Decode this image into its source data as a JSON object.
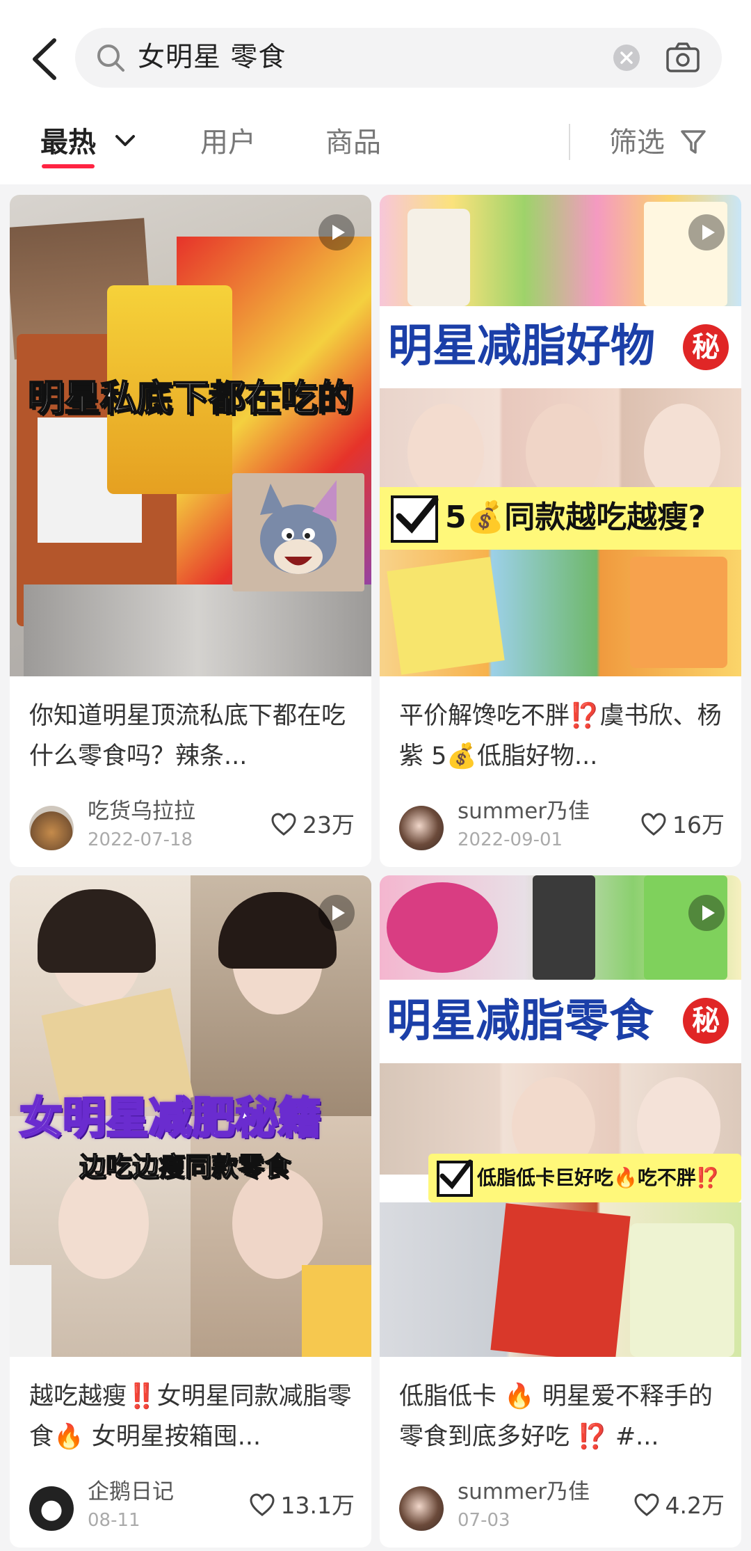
{
  "search": {
    "query": "女明星 零食"
  },
  "tabs": [
    {
      "label": "最热"
    },
    {
      "label": "用户"
    },
    {
      "label": "商品"
    },
    {
      "label": "筛选"
    }
  ],
  "cards": [
    {
      "overlay": "明星私底下都在吃的",
      "title": "你知道明星顶流私底下都在吃什么零食吗？辣条...",
      "author": "吃货乌拉拉",
      "date": "2022-07-18",
      "likes": "23万"
    },
    {
      "overlay": "明星减脂好物",
      "overlay_badge": "秘",
      "overlay2": "5💰同款越吃越瘦?",
      "title": "平价解馋吃不胖⁉️虞书欣、杨紫 5💰低脂好物...",
      "author": "summer乃佳",
      "date": "2022-09-01",
      "likes": "16万"
    },
    {
      "overlay": "女明星减肥秘籍",
      "overlay2": "边吃边瘦同款零食",
      "title": "越吃越瘦‼️女明星同款减脂零食🔥 女明星按箱囤...",
      "author": "企鹅日记",
      "date": "08-11",
      "likes": "13.1万"
    },
    {
      "overlay": "明星减脂零食",
      "overlay_badge": "秘",
      "overlay2": "低脂低卡巨好吃🔥吃不胖⁉️",
      "title": "低脂低卡 🔥 明星爱不释手的零食到底多好吃 ⁉️ #...",
      "author": "summer乃佳",
      "date": "07-03",
      "likes": "4.2万"
    }
  ],
  "colors": {
    "accent": "#ff2442",
    "blue_banner": "#1b3fa8"
  },
  "icons": [
    "back-arrow-icon",
    "search-icon",
    "clear-icon",
    "camera-icon",
    "chevron-down-icon",
    "filter-icon",
    "play-icon",
    "heart-icon"
  ]
}
